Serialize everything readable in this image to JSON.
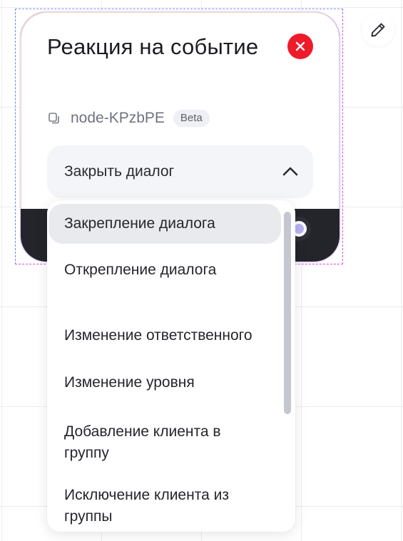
{
  "node": {
    "title": "Реакция на событие",
    "id": "node-KPzbPE",
    "badge": "Beta"
  },
  "select": {
    "value": "Закрыть диалог"
  },
  "dropdown": {
    "items": [
      {
        "label": "Закрепление диалога"
      },
      {
        "label": "Открепление диалога"
      },
      {
        "label": "Изменение ответственного"
      },
      {
        "label": "Изменение уровня"
      },
      {
        "label": "Добавление клиента в группу"
      },
      {
        "label": "Исключение клиента из группы"
      }
    ],
    "highlighted_index": 0
  },
  "icons": {
    "edit": "pencil-icon",
    "close": "close-icon",
    "copy": "copy-icon",
    "chevron": "chevron-up-icon"
  },
  "colors": {
    "close": "#ee1b2b",
    "card_bottom": "#23252b",
    "selection_frame": "#d44fe0",
    "handle": "#b8b3f2"
  }
}
